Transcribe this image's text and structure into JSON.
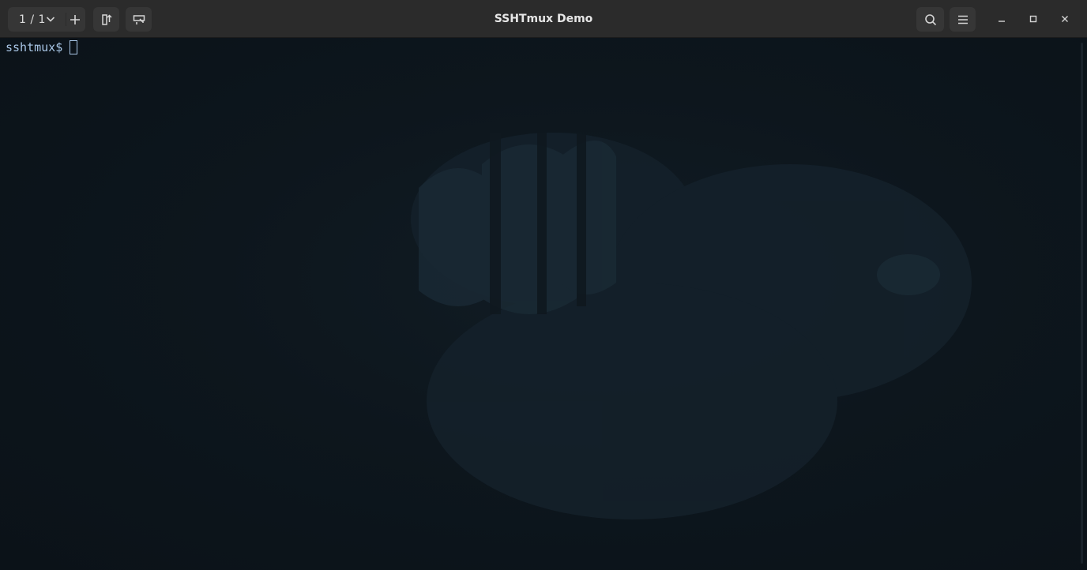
{
  "window": {
    "title": "SSHTmux Demo"
  },
  "headerbar": {
    "tab_count": "1 / 1",
    "icons": {
      "tab_dropdown": "chevron-down-icon",
      "new_tab": "plus-icon",
      "detach": "export-icon",
      "rename": "rename-icon",
      "search": "search-icon",
      "menu": "hamburger-menu-icon",
      "minimize": "minimize-icon",
      "maximize": "maximize-icon",
      "close": "close-icon"
    }
  },
  "terminal": {
    "prompt": "sshtmux$ ",
    "input": "",
    "colors": {
      "background": "#0c131a",
      "foreground": "#a9c6e6"
    }
  }
}
